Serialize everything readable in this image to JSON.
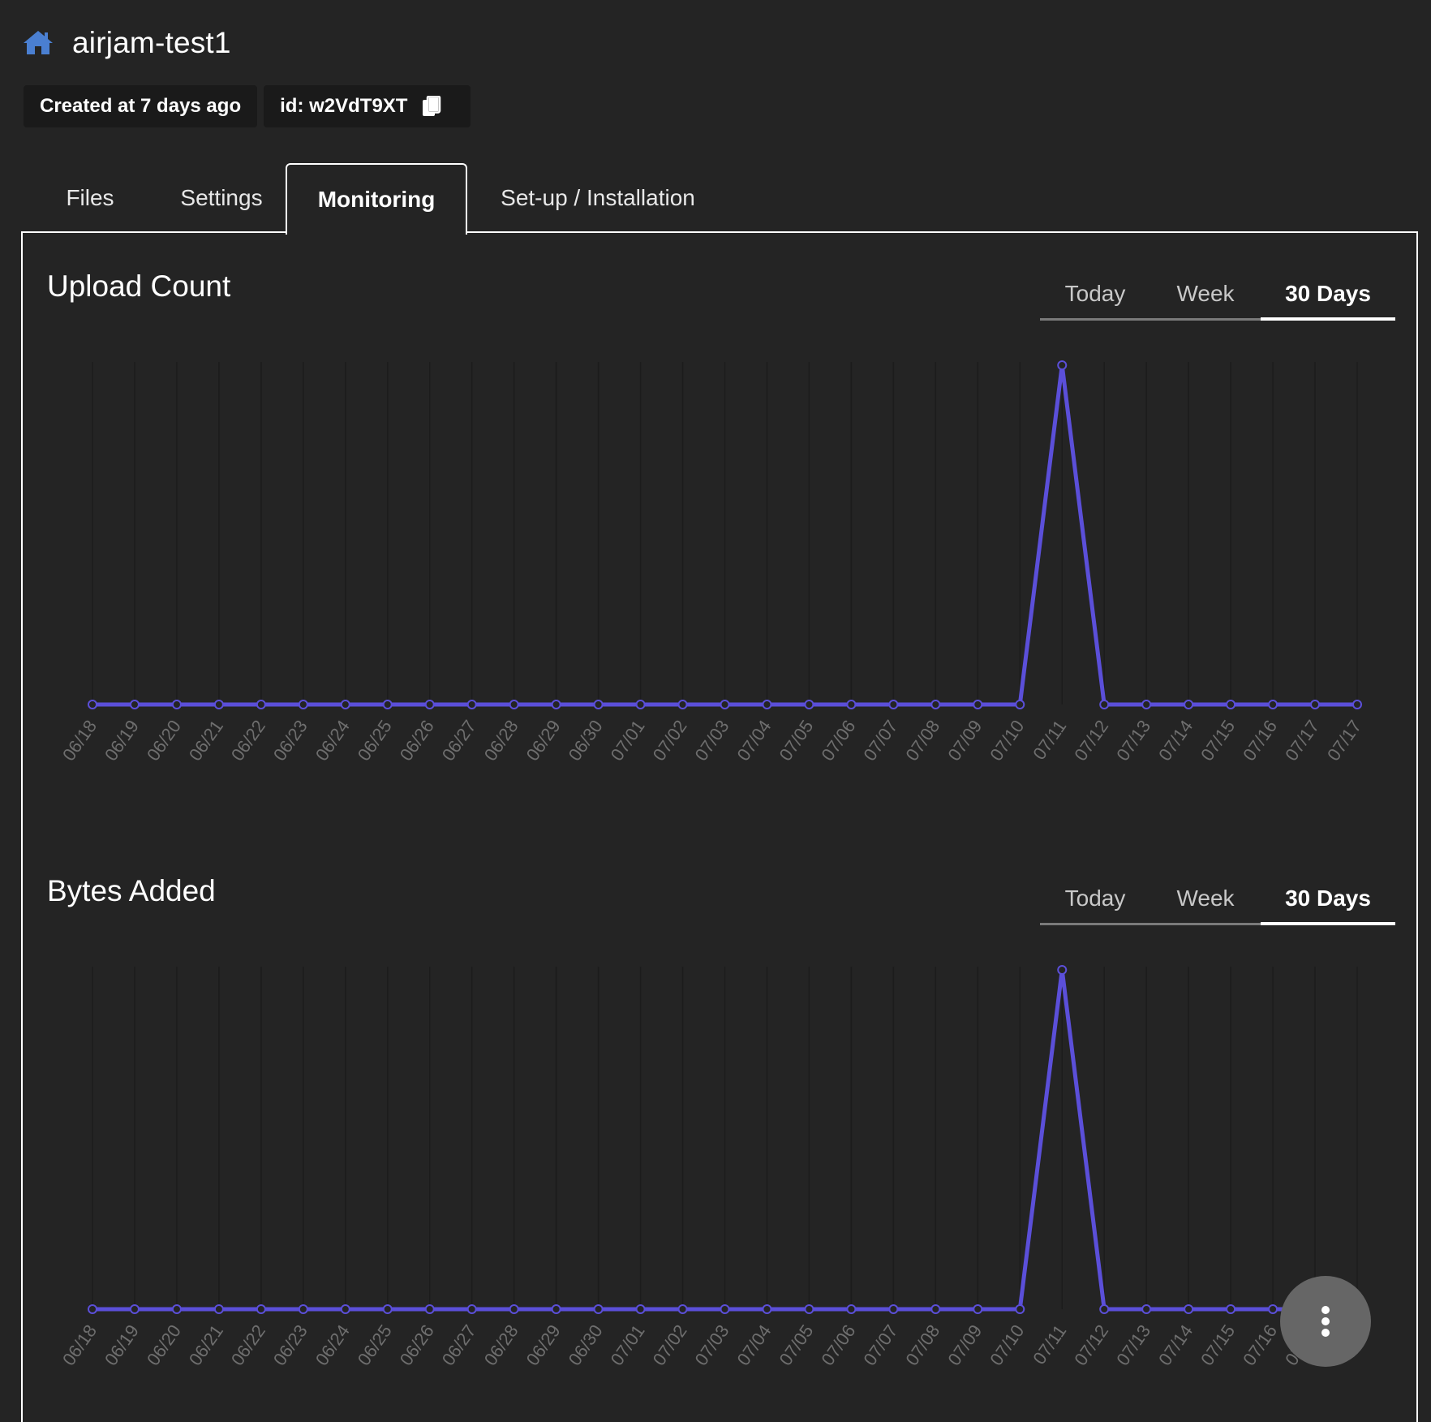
{
  "header": {
    "title": "airjam-test1",
    "created_label": "Created at 7 days ago",
    "id_label": "id: w2VdT9XT"
  },
  "tabs": [
    {
      "label": "Files"
    },
    {
      "label": "Settings"
    },
    {
      "label": "Monitoring"
    },
    {
      "label": "Set-up / Installation"
    }
  ],
  "active_tab": "Monitoring",
  "range_options": [
    "Today",
    "Week",
    "30 Days"
  ],
  "colors": {
    "accent": "#5b4fd9",
    "background": "#242424",
    "chip_background": "#1a1a1a",
    "fab": "#666666"
  },
  "icons": {
    "home": "home-icon",
    "copy": "copy-icon",
    "more": "more-vertical-icon"
  },
  "chart_data": [
    {
      "type": "line",
      "title": "Upload Count",
      "selected_range": "30 Days",
      "x": [
        "06/18",
        "06/19",
        "06/20",
        "06/21",
        "06/22",
        "06/23",
        "06/24",
        "06/25",
        "06/26",
        "06/27",
        "06/28",
        "06/29",
        "06/30",
        "07/01",
        "07/02",
        "07/03",
        "07/04",
        "07/05",
        "07/06",
        "07/07",
        "07/08",
        "07/09",
        "07/10",
        "07/11",
        "07/12",
        "07/13",
        "07/14",
        "07/15",
        "07/16",
        "07/17",
        "07/17"
      ],
      "values": [
        0,
        0,
        0,
        0,
        0,
        0,
        0,
        0,
        0,
        0,
        0,
        0,
        0,
        0,
        0,
        0,
        0,
        0,
        0,
        0,
        0,
        0,
        0,
        1,
        0,
        0,
        0,
        0,
        0,
        0,
        0
      ],
      "ylim": [
        0,
        1
      ],
      "grid": "vertical"
    },
    {
      "type": "line",
      "title": "Bytes Added",
      "selected_range": "30 Days",
      "x": [
        "06/18",
        "06/19",
        "06/20",
        "06/21",
        "06/22",
        "06/23",
        "06/24",
        "06/25",
        "06/26",
        "06/27",
        "06/28",
        "06/29",
        "06/30",
        "07/01",
        "07/02",
        "07/03",
        "07/04",
        "07/05",
        "07/06",
        "07/07",
        "07/08",
        "07/09",
        "07/10",
        "07/11",
        "07/12",
        "07/13",
        "07/14",
        "07/15",
        "07/16",
        "07/17",
        "07/17"
      ],
      "values": [
        0,
        0,
        0,
        0,
        0,
        0,
        0,
        0,
        0,
        0,
        0,
        0,
        0,
        0,
        0,
        0,
        0,
        0,
        0,
        0,
        0,
        0,
        0,
        1,
        0,
        0,
        0,
        0,
        0,
        0,
        0
      ],
      "ylim": [
        0,
        1
      ],
      "grid": "vertical"
    }
  ]
}
